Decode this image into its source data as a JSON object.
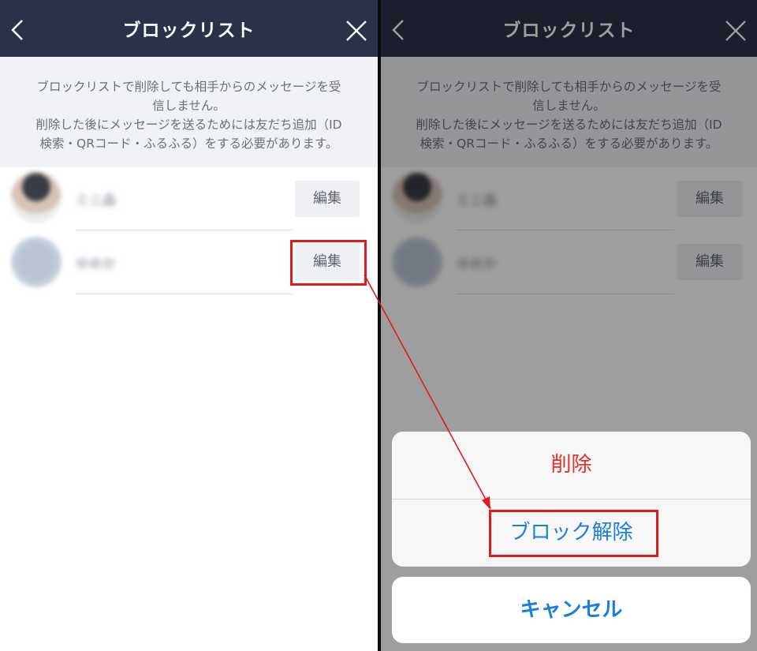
{
  "header": {
    "title": "ブロックリスト"
  },
  "notice": {
    "lines": [
      "ブロックリストで削除しても相手からのメッセージを受",
      "信しません。",
      "削除した後にメッセージを送るためには友だち追加（ID",
      "検索・QRコード・ふるふる）をする必要があります。"
    ]
  },
  "contacts": [
    {
      "name": "ミニ森",
      "edit_label": "編集"
    },
    {
      "name": "ゆめか",
      "edit_label": "編集"
    }
  ],
  "action_sheet": {
    "delete_label": "削除",
    "unblock_label": "ブロック解除",
    "cancel_label": "キャンセル"
  },
  "colors": {
    "header_bg": "#2a3149",
    "destructive": "#e0312b",
    "action_blue": "#1a7ee0",
    "highlight": "#e01b1b"
  }
}
